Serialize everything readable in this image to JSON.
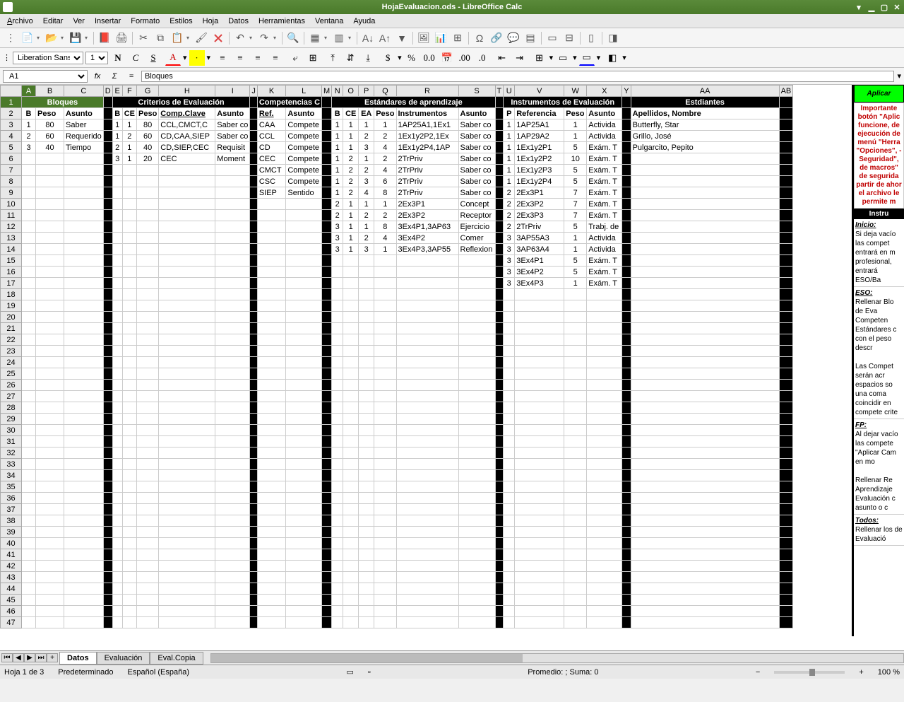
{
  "window": {
    "title": "HojaEvaluacion.ods - LibreOffice Calc"
  },
  "menu": [
    "Archivo",
    "Editar",
    "Ver",
    "Insertar",
    "Formato",
    "Estilos",
    "Hoja",
    "Datos",
    "Herramientas",
    "Ventana",
    "Ayuda"
  ],
  "font": {
    "name": "Liberation Sans",
    "size": "10"
  },
  "namebox": "A1",
  "formula": "Bloques",
  "columns": [
    "A",
    "B",
    "C",
    "D",
    "E",
    "F",
    "G",
    "H",
    "I",
    "J",
    "K",
    "L",
    "M",
    "N",
    "O",
    "P",
    "Q",
    "R",
    "S",
    "T",
    "U",
    "V",
    "W",
    "X",
    "Y",
    "AA",
    "AB"
  ],
  "section_headers": {
    "bloques": "Bloques",
    "criterios": "Criterios de Evaluación",
    "competencias": "Competencias C",
    "estandares": "Estándares de aprendizaje",
    "instrumentos": "Instrumentos de Evaluación",
    "estudiantes": "Estdiantes"
  },
  "col_headers": {
    "A": "B",
    "B": "Peso",
    "C": "Asunto",
    "E": "B",
    "F": "CE",
    "G": "Peso",
    "H": "Comp.Clave",
    "I": "Asunto",
    "K": "Ref.",
    "L": "Asunto",
    "N": "B",
    "O": "CE",
    "P": "EA",
    "Q": "Peso",
    "R": "Instrumentos",
    "S": "Asunto",
    "U": "P",
    "V": "Referencia",
    "W": "Peso",
    "X": "Asunto",
    "AA": "Apellidos, Nombre"
  },
  "bloques": [
    {
      "b": "1",
      "peso": "80",
      "asunto": "Saber"
    },
    {
      "b": "2",
      "peso": "60",
      "asunto": "Requerido"
    },
    {
      "b": "3",
      "peso": "40",
      "asunto": "Tiempo"
    }
  ],
  "criterios": [
    {
      "b": "1",
      "ce": "1",
      "peso": "80",
      "comp": "CCL,CMCT,C",
      "asunto": "Saber co"
    },
    {
      "b": "1",
      "ce": "2",
      "peso": "60",
      "comp": "CD,CAA,SIEP",
      "asunto": "Saber co"
    },
    {
      "b": "2",
      "ce": "1",
      "peso": "40",
      "comp": "CD,SIEP,CEC",
      "asunto": "Requisit"
    },
    {
      "b": "3",
      "ce": "1",
      "peso": "20",
      "comp": "CEC",
      "asunto": "Moment"
    }
  ],
  "competencias": [
    {
      "ref": "CAA",
      "asunto": "Compete"
    },
    {
      "ref": "CCL",
      "asunto": "Compete"
    },
    {
      "ref": "CD",
      "asunto": "Compete"
    },
    {
      "ref": "CEC",
      "asunto": "Compete"
    },
    {
      "ref": "CMCT",
      "asunto": "Compete"
    },
    {
      "ref": "CSC",
      "asunto": "Compete"
    },
    {
      "ref": "SIEP",
      "asunto": "Sentido"
    }
  ],
  "estandares": [
    {
      "b": "1",
      "ce": "1",
      "ea": "1",
      "peso": "1",
      "instr": "1AP25A1,1Ex1",
      "asunto": "Saber co"
    },
    {
      "b": "1",
      "ce": "1",
      "ea": "2",
      "peso": "2",
      "instr": "1Ex1y2P2,1Ex",
      "asunto": "Saber co"
    },
    {
      "b": "1",
      "ce": "1",
      "ea": "3",
      "peso": "4",
      "instr": "1Ex1y2P4,1AP",
      "asunto": "Saber co"
    },
    {
      "b": "1",
      "ce": "2",
      "ea": "1",
      "peso": "2",
      "instr": "2TrPriv",
      "asunto": "Saber co"
    },
    {
      "b": "1",
      "ce": "2",
      "ea": "2",
      "peso": "4",
      "instr": "2TrPriv",
      "asunto": "Saber co"
    },
    {
      "b": "1",
      "ce": "2",
      "ea": "3",
      "peso": "6",
      "instr": "2TrPriv",
      "asunto": "Saber co"
    },
    {
      "b": "1",
      "ce": "2",
      "ea": "4",
      "peso": "8",
      "instr": "2TrPriv",
      "asunto": "Saber co"
    },
    {
      "b": "2",
      "ce": "1",
      "ea": "1",
      "peso": "1",
      "instr": "2Ex3P1",
      "asunto": "Concept"
    },
    {
      "b": "2",
      "ce": "1",
      "ea": "2",
      "peso": "2",
      "instr": "2Ex3P2",
      "asunto": "Receptor"
    },
    {
      "b": "3",
      "ce": "1",
      "ea": "1",
      "peso": "8",
      "instr": "3Ex4P1,3AP63",
      "asunto": "Ejercicio"
    },
    {
      "b": "3",
      "ce": "1",
      "ea": "2",
      "peso": "4",
      "instr": "3Ex4P2",
      "asunto": "Comer"
    },
    {
      "b": "3",
      "ce": "1",
      "ea": "3",
      "peso": "1",
      "instr": "3Ex4P3,3AP55",
      "asunto": "Reflexion"
    }
  ],
  "instrumentos": [
    {
      "p": "1",
      "ref": "1AP25A1",
      "peso": "1",
      "asunto": "Activida"
    },
    {
      "p": "1",
      "ref": "1AP29A2",
      "peso": "1",
      "asunto": "Activida"
    },
    {
      "p": "1",
      "ref": "1Ex1y2P1",
      "peso": "5",
      "asunto": "Exám. T"
    },
    {
      "p": "1",
      "ref": "1Ex1y2P2",
      "peso": "10",
      "asunto": "Exám. T"
    },
    {
      "p": "1",
      "ref": "1Ex1y2P3",
      "peso": "5",
      "asunto": "Exám. T"
    },
    {
      "p": "1",
      "ref": "1Ex1y2P4",
      "peso": "5",
      "asunto": "Exám. T"
    },
    {
      "p": "2",
      "ref": "2Ex3P1",
      "peso": "7",
      "asunto": "Exám. T"
    },
    {
      "p": "2",
      "ref": "2Ex3P2",
      "peso": "7",
      "asunto": "Exám. T"
    },
    {
      "p": "2",
      "ref": "2Ex3P3",
      "peso": "7",
      "asunto": "Exám. T"
    },
    {
      "p": "2",
      "ref": "2TrPriv",
      "peso": "5",
      "asunto": "Trabj. de"
    },
    {
      "p": "3",
      "ref": "3AP55A3",
      "peso": "1",
      "asunto": "Activida"
    },
    {
      "p": "3",
      "ref": "3AP63A4",
      "peso": "1",
      "asunto": "Activida"
    },
    {
      "p": "3",
      "ref": "3Ex4P1",
      "peso": "5",
      "asunto": "Exám. T"
    },
    {
      "p": "3",
      "ref": "3Ex4P2",
      "peso": "5",
      "asunto": "Exám. T"
    },
    {
      "p": "3",
      "ref": "3Ex4P3",
      "peso": "1",
      "asunto": "Exám. T"
    }
  ],
  "estudiantes": [
    "Butterfly, Star",
    "Grillo, José",
    "Pulgarcito, Pepito"
  ],
  "sidebar": {
    "button": "Aplicar",
    "warning": "Importante botón \"Aplic funcione, de ejecución de menú \"Herra \"Opciones\", - Seguridad\", de macros\" de segurida partir de ahor el archivo le permite m",
    "instr_hdr": "Instru",
    "sections": [
      {
        "h": "Inicio:",
        "t": "Si deja vacío las compet entrará en m profesional, entrará ESO/Ba"
      },
      {
        "h": "ESO:",
        "t": "Rellenar Blo de Eva Competen Estándares c con el peso descr\n\nLas Compet serán acr espacios so una coma coincidir en compete crite"
      },
      {
        "h": "FP:",
        "t": "Al dejar vacío las compete \"Aplicar Cam en mo\n\nRellenar Re Aprendizaje Evaluación c asunto o c"
      },
      {
        "h": "Todos:",
        "t": "Rellenar los de Evaluació"
      }
    ]
  },
  "tabs": {
    "items": [
      "Datos",
      "Evaluación",
      "Eval.Copia"
    ],
    "active": 0
  },
  "status": {
    "sheet": "Hoja 1 de 3",
    "style": "Predeterminado",
    "lang": "Español (España)",
    "avg": "Promedio: ; Suma: 0",
    "zoom": "100 %"
  }
}
